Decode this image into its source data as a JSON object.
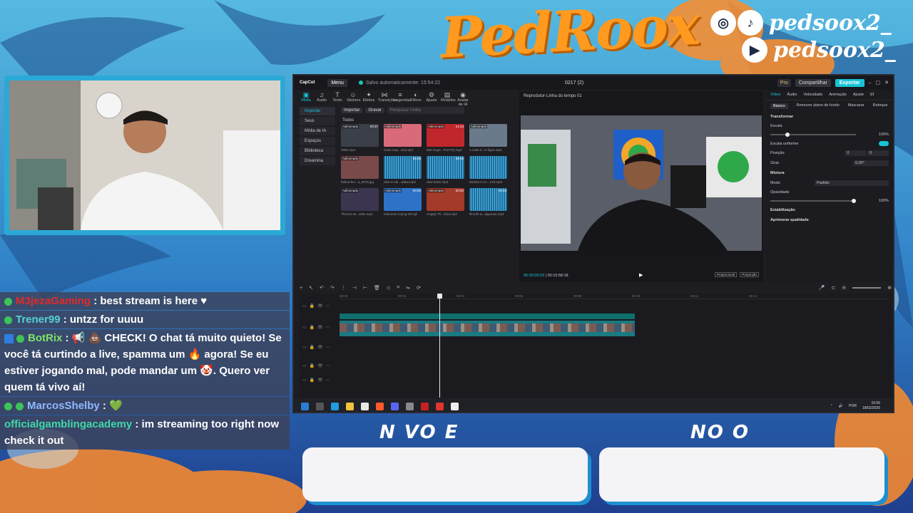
{
  "overlay": {
    "logo_text": "PedRoox",
    "social": [
      {
        "icons": [
          "instagram-icon",
          "tiktok-icon"
        ],
        "glyphs": [
          "◎",
          "♪"
        ],
        "handle": "pedsoox2_"
      },
      {
        "icons": [
          "youtube-icon"
        ],
        "glyphs": [
          "▶"
        ],
        "handle": "pedsoox2_"
      }
    ],
    "goal_left_label": "N VO E",
    "goal_right_label": "NO O"
  },
  "chat": [
    {
      "user": "M3jezaGaming",
      "user_color": "#e02a2a",
      "badges": [
        "verified"
      ],
      "text": " : best stream is here ♥"
    },
    {
      "user": "Trener99",
      "user_color": "#56d2d6",
      "badges": [
        "verified"
      ],
      "text": " : untzz for uuuu"
    },
    {
      "user": "BotRix",
      "user_color": "#7de26a",
      "badges": [
        "bot",
        "verified"
      ],
      "text": " : 📢 💩 CHECK! O chat tá muito quieto! Se você tá curtindo a live, spamma um 🔥 agora! Se eu estiver jogando mal, pode mandar um 🤡. Quero ver quem tá vivo aí!"
    },
    {
      "user": "MarcosShelby",
      "user_color": "#8fb8ff",
      "badges": [
        "verified",
        "sub"
      ],
      "text": " : 💚"
    },
    {
      "user": "officialgamblingacademy",
      "user_color": "#3fd8a8",
      "badges": [],
      "text": " : im streaming too right now check it out"
    }
  ],
  "editor": {
    "brand": "CapCut",
    "menu": "Menu",
    "autosave": "Salvo automaticamente: 15:54:22",
    "project": "0217 (2)",
    "pro": "Pro",
    "share": "Compartilhar",
    "export": "Exportar",
    "tools": [
      {
        "g": "▣",
        "label": "Mídia"
      },
      {
        "g": "♫",
        "label": "Áudio"
      },
      {
        "g": "T",
        "label": "Texto"
      },
      {
        "g": "☺",
        "label": "Stickers"
      },
      {
        "g": "✦",
        "label": "Efeitos"
      },
      {
        "g": "⋈",
        "label": "Transições"
      },
      {
        "g": "≡",
        "label": "Legendas"
      },
      {
        "g": "◐",
        "label": "Filtros"
      },
      {
        "g": "⚙",
        "label": "Ajuste"
      },
      {
        "g": "▤",
        "label": "Modelos"
      },
      {
        "g": "◉",
        "label": "Avatar de IA"
      }
    ],
    "sidebar": [
      "Importar",
      "Seus",
      "Mídia de IA",
      "Espaços",
      "Biblioteca",
      "Dreamina"
    ],
    "media_top": {
      "import": "Importar",
      "record": "Gravar",
      "search_placeholder": "Pesquisar mídia"
    },
    "todos": "Todos",
    "thumbs": [
      {
        "tag": "Adicionado",
        "dur": "00:37",
        "name": "0080.mp4",
        "color": "#3a3f4a"
      },
      {
        "tag": "Adicionado",
        "dur": "",
        "name": "Goku Sup...ow(.mp4",
        "color": "#d96a7a"
      },
      {
        "tag": "Adicionado",
        "dur": "21:43",
        "name": "MKI Supe...PLETO).mp4",
        "color": "#c0272d"
      },
      {
        "tag": "Adicionado",
        "dur": "",
        "name": "A noite d...D figue.mp4",
        "color": "#6b7a8a"
      },
      {
        "tag": "Adicionado",
        "dur": "",
        "name": "fatima-ber...a_0079.jpg",
        "color": "#7a4a4a"
      },
      {
        "tag": "",
        "dur": "00:05",
        "name": "olhe-m-de...olaba.mp3",
        "color": "#1f6f9a"
      },
      {
        "tag": "",
        "dur": "00:02",
        "name": "olee-bram.mp3",
        "color": "#1f6f9a"
      },
      {
        "tag": "",
        "dur": "",
        "name": "MUSICA CA...CHI.mp3",
        "color": "#1f6f9a"
      },
      {
        "tag": "Adicionado",
        "dur": "",
        "name": "Thenze-sa...Jake.mp4",
        "color": "#3b3550"
      },
      {
        "tag": "Adicionado",
        "dur": "00:05",
        "name": "Interview Crying-GIF.gif",
        "color": "#2e72c8"
      },
      {
        "tag": "Adicionado",
        "dur": "00:02",
        "name": "Angaly Th...Clas.mp4",
        "color": "#a33a2a"
      },
      {
        "tag": "",
        "dur": "00:03",
        "name": "filmofe-w...algumas.mp3",
        "color": "#1f6f9a"
      }
    ],
    "player": {
      "title": "Reprodutor-Linha do tempo 01",
      "current": "00:00:09:03",
      "total": "00:15:58:18",
      "btn_fullscreen": "Proporcional",
      "btn_ratio": "Proporção"
    },
    "props": {
      "tabs": [
        "Vídeo",
        "Áudio",
        "Velocidade",
        "Animação",
        "Ajuste",
        "Ef"
      ],
      "subtabs": [
        "Básico",
        "Remover plano de fundo",
        "Mascarar",
        "Retoque"
      ],
      "transform": "Transformar",
      "scale_label": "Escala",
      "scale_value": "100%",
      "scale_level": 0.18,
      "uniform": "Escala uniforme",
      "position": "Posição",
      "pos_x": "0",
      "pos_y": "0",
      "rotate": "Girar",
      "rotate_value": "0,00°",
      "blend": "Mistura",
      "mode": "Modo",
      "mode_value": "Padrão",
      "opacity": "Opacidade",
      "opacity_value": "100%",
      "opacity_level": 1.0,
      "stabilize": "Estabilização",
      "enhance": "Aprimorar qualidade"
    },
    "ruler": [
      "00:00",
      "00:01",
      "00:04",
      "00:06",
      "00:08",
      "00:10",
      "00:12",
      "00:14"
    ],
    "taskbar_time": "15:56",
    "taskbar_date": "18/02/2026",
    "taskbar_lang": "POR"
  }
}
